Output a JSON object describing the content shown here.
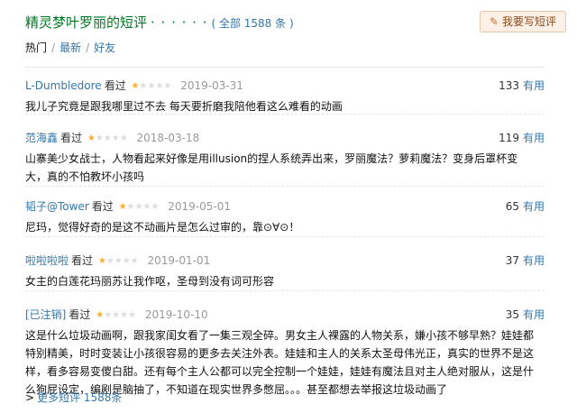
{
  "header": {
    "title": "精灵梦叶罗丽的短评",
    "dots": "· · · · · ·",
    "count_text": "( 全部 1588 条 )",
    "write_button": "我要写短评",
    "write_icon": "pencil-icon"
  },
  "filters": {
    "current": "热门",
    "latest": "最新",
    "friends": "好友"
  },
  "reviews": [
    {
      "user": "L-Dumbledore",
      "status": "看过",
      "rating": 1,
      "date": "2019-03-31",
      "votes": "133",
      "useful_label": "有用",
      "text": "我儿子究竟是跟我哪里过不去 每天要折磨我陪他看这么难看的动画"
    },
    {
      "user": "范海鑫",
      "status": "看过",
      "rating": 1,
      "date": "2018-03-18",
      "votes": "119",
      "useful_label": "有用",
      "text": "山寨美少女战士，人物看起来好像是用illusion的捏人系统弄出来，罗丽魔法？萝莉魔法？变身后罩杯变大，真的不怕教坏小孩吗"
    },
    {
      "user": "韬子@Tower",
      "status": "看过",
      "rating": 1,
      "date": "2019-05-01",
      "votes": "65",
      "useful_label": "有用",
      "text": "尼玛，觉得好奇的是这不动画片是怎么过审的，靠⊙∀⊙！"
    },
    {
      "user": "啦啦啦啦",
      "status": "看过",
      "rating": 1,
      "date": "2019-01-01",
      "votes": "37",
      "useful_label": "有用",
      "text": "女主的白莲花玛丽苏让我作呕，圣母到没有词可形容"
    },
    {
      "user": "[已注销]",
      "status": "看过",
      "rating": 1,
      "date": "2019-10-10",
      "votes": "35",
      "useful_label": "有用",
      "text": "这是什么垃圾动画啊，跟我家闺女看了一集三观全碎。男女主人裸露的人物关系，嫌小孩不够早熟？娃娃都特别精美，时时变装让小孩很容易的更多去关注外表。娃娃和主人的关系太圣母伟光正，真实的世界不是这样，看多容易变傻白甜。还有每个主人公都可以完全控制一个娃娃，娃娃有魔法且对主人绝对服从，这是什么狗屁设定，编剧是脑抽了，不知道在现实世界多憋屈。。。甚至都想去举报这垃圾动画了"
    }
  ],
  "more": {
    "arrow": ">",
    "label": "更多短评 1588条"
  }
}
